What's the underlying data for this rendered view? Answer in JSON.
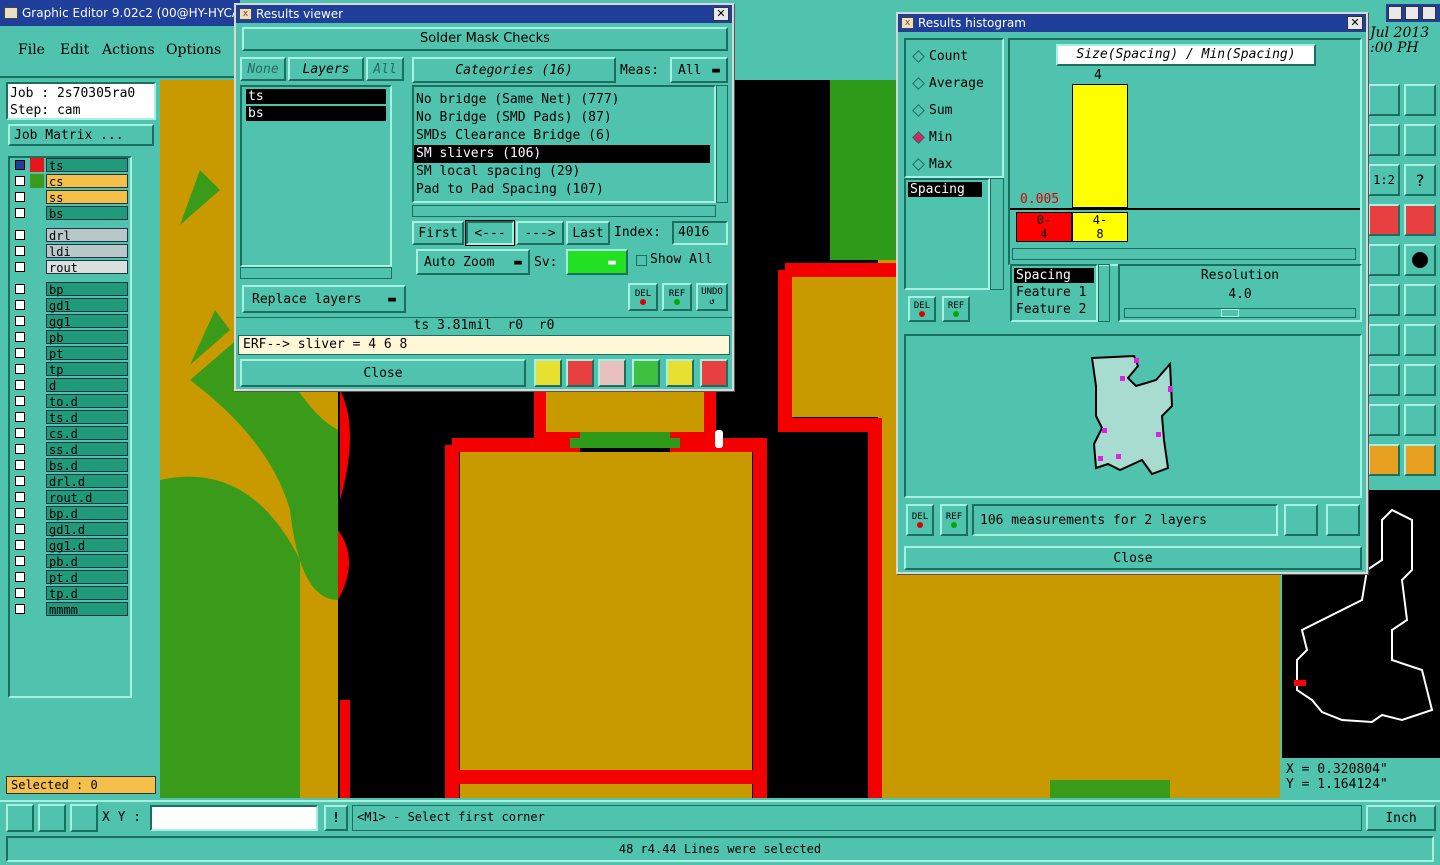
{
  "app": {
    "title": "Graphic Editor 9.02c2 (00@HY-HYCAM",
    "menu": [
      "File",
      "Edit",
      "Actions",
      "Options"
    ],
    "datetime_line1": "Jul 2013",
    "datetime_line2": ":00 PH"
  },
  "job": {
    "job_label": "Job : 2s70305ra0",
    "step_label": "Step: cam",
    "matrix_button": "Job Matrix ..."
  },
  "layers": [
    {
      "name": "ts",
      "color": "#1f9a7a",
      "swatch": "#e8151a"
    },
    {
      "name": "cs",
      "color": "#f5c04a",
      "swatch": "#3a9a1a"
    },
    {
      "name": "ss",
      "color": "#f5c04a",
      "swatch": ""
    },
    {
      "name": "bs",
      "color": "#1f9a7a",
      "swatch": ""
    },
    {
      "name": "drl",
      "color": "#b8c8c8",
      "swatch": ""
    },
    {
      "name": "ldi",
      "color": "#b8c8c8",
      "swatch": ""
    },
    {
      "name": "rout",
      "color": "#d8e0e0",
      "swatch": ""
    },
    {
      "name": "bp",
      "color": "#1f9a7a",
      "swatch": ""
    },
    {
      "name": "gd1",
      "color": "#1f9a7a",
      "swatch": ""
    },
    {
      "name": "gg1",
      "color": "#1f9a7a",
      "swatch": ""
    },
    {
      "name": "pb",
      "color": "#1f9a7a",
      "swatch": ""
    },
    {
      "name": "pt",
      "color": "#1f9a7a",
      "swatch": ""
    },
    {
      "name": "tp",
      "color": "#1f9a7a",
      "swatch": ""
    },
    {
      "name": "d",
      "color": "#1f9a7a",
      "swatch": ""
    },
    {
      "name": "to.d",
      "color": "#1f9a7a",
      "swatch": ""
    },
    {
      "name": "ts.d",
      "color": "#1f9a7a",
      "swatch": ""
    },
    {
      "name": "cs.d",
      "color": "#1f9a7a",
      "swatch": ""
    },
    {
      "name": "ss.d",
      "color": "#1f9a7a",
      "swatch": ""
    },
    {
      "name": "bs.d",
      "color": "#1f9a7a",
      "swatch": ""
    },
    {
      "name": "drl.d",
      "color": "#1f9a7a",
      "swatch": ""
    },
    {
      "name": "rout.d",
      "color": "#1f9a7a",
      "swatch": ""
    },
    {
      "name": "bp.d",
      "color": "#1f9a7a",
      "swatch": ""
    },
    {
      "name": "gd1.d",
      "color": "#1f9a7a",
      "swatch": ""
    },
    {
      "name": "gg1.d",
      "color": "#1f9a7a",
      "swatch": ""
    },
    {
      "name": "pb.d",
      "color": "#1f9a7a",
      "swatch": ""
    },
    {
      "name": "pt.d",
      "color": "#1f9a7a",
      "swatch": ""
    },
    {
      "name": "tp.d",
      "color": "#1f9a7a",
      "swatch": ""
    },
    {
      "name": "mmmm",
      "color": "#1f9a7a",
      "swatch": ""
    }
  ],
  "selected_label": "Selected : 0",
  "results_viewer": {
    "title": "Results viewer",
    "heading": "Solder Mask Checks",
    "none_btn": "None",
    "layers_btn": "Layers",
    "all_btn": "All",
    "layer_list": [
      "ts",
      "bs"
    ],
    "categories_btn": "Categories (16)",
    "meas_label": "Meas:",
    "meas_value": "All",
    "categories": [
      "No bridge (Same Net) (777)",
      "No Bridge (SMD Pads) (87)",
      "SMDs Clearance Bridge (6)",
      "SM slivers (106)",
      "SM local spacing (29)",
      "Pad to Pad Spacing (107)"
    ],
    "selected_category": 3,
    "first_btn": "First",
    "prev_btn": "<---",
    "next_btn": "--->",
    "last_btn": "Last",
    "index_label": "Index:",
    "index_value": "4016",
    "auto_zoom": "Auto Zoom",
    "sv_label": "Sv:",
    "show_all": "Show All",
    "replace_layers": "Replace layers",
    "del_label": "DEL",
    "ref_label": "REF",
    "undo_label": "UNDO",
    "info_line": "ts 3.81mil  r0  r0",
    "erf_line": "ERF--> sliver = 4 6 8",
    "close_btn": "Close"
  },
  "histogram": {
    "title": "Results histogram",
    "modes": [
      "Count",
      "Average",
      "Sum",
      "Min",
      "Max"
    ],
    "selected_mode": "Min",
    "chart_title": "Size(Spacing) / Min(Spacing)",
    "bar_value_label": "4",
    "min_value_label": "0.005",
    "bins": [
      {
        "label_top": "0-",
        "label_bottom": "4",
        "color": "#ff0000"
      },
      {
        "label_top": "4-",
        "label_bottom": "8",
        "color": "#ffff00"
      }
    ],
    "spacing_list": [
      "Spacing"
    ],
    "measure_items": [
      "Spacing",
      "Feature 1",
      "Feature 2"
    ],
    "resolution_label": "Resolution",
    "resolution_value": "4.0",
    "measurements_text": "106 measurements for 2 layers",
    "close_btn": "Close",
    "del_label": "DEL",
    "ref_label": "REF"
  },
  "coords": {
    "x": "X = 0.320804\"",
    "y": "Y = 1.164124\""
  },
  "bottom": {
    "xy_label": "X Y :",
    "xy_value": "",
    "prompt": "<M1> - Select first corner",
    "unit": "Inch",
    "status": "48 r4.44 Lines were selected"
  }
}
